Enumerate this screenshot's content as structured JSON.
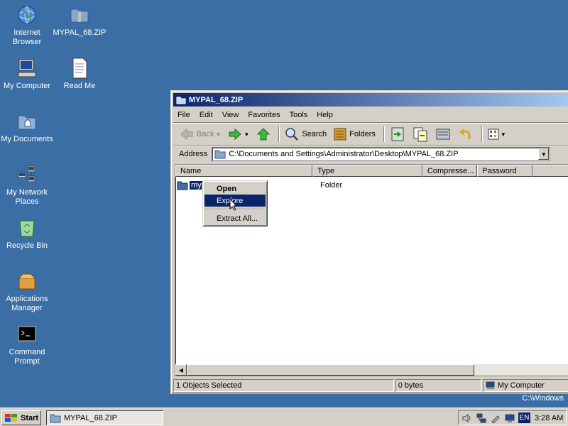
{
  "desktop": {
    "icons": [
      {
        "label": "Internet Browser",
        "icon": "globe-icon"
      },
      {
        "label": "MYPAL_68.ZIP",
        "icon": "zip-folder-icon"
      },
      {
        "label": "My Computer",
        "icon": "computer-icon"
      },
      {
        "label": "Read Me",
        "icon": "document-icon"
      },
      {
        "label": "My Documents",
        "icon": "folder-icon"
      },
      {
        "label": "My Network Places",
        "icon": "network-icon"
      },
      {
        "label": "Recycle Bin",
        "icon": "recycle-bin-icon"
      },
      {
        "label": "Applications Manager",
        "icon": "box-icon"
      },
      {
        "label": "Command Prompt",
        "icon": "terminal-icon"
      }
    ],
    "watermark": "C:\\Windows"
  },
  "window": {
    "title": "MYPAL_68.ZIP",
    "menu": [
      "File",
      "Edit",
      "View",
      "Favorites",
      "Tools",
      "Help"
    ],
    "toolbar": {
      "back": "Back",
      "search": "Search",
      "folders": "Folders"
    },
    "address": {
      "label": "Address",
      "value": "C:\\Documents and Settings\\Administrator\\Desktop\\MYPAL_68.ZIP"
    },
    "columns": [
      "Name",
      "Type",
      "Compresse...",
      "Password"
    ],
    "rows": [
      {
        "name": "myp",
        "type": "Folder"
      }
    ],
    "status": {
      "selection": "1 Objects Selected",
      "size": "0 bytes",
      "location": "My Computer"
    }
  },
  "context_menu": {
    "items": [
      "Open",
      "Explore",
      "Extract All..."
    ],
    "highlighted": "Explore"
  },
  "taskbar": {
    "start": "Start",
    "task": "MYPAL_68.ZIP",
    "lang": "EN",
    "clock": "3:28 AM"
  }
}
